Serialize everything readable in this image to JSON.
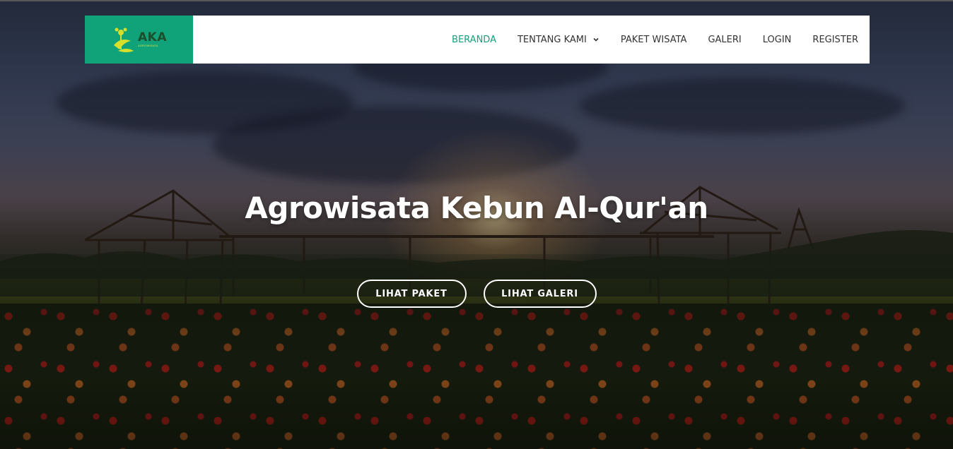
{
  "logo": {
    "title": "AKA",
    "subtitle": "AGROWISATA",
    "icon": "leaf-flower-icon",
    "bg_color": "#10a37a"
  },
  "nav": {
    "items": [
      {
        "label": "BERANDA",
        "active": true
      },
      {
        "label": "TENTANG KAMI",
        "has_dropdown": true
      },
      {
        "label": "PAKET WISATA"
      },
      {
        "label": "GALERI"
      },
      {
        "label": "LOGIN"
      },
      {
        "label": "REGISTER"
      }
    ],
    "active_color": "#10a37a",
    "text_color": "#333333",
    "dropdown_icon": "chevron-down-icon"
  },
  "hero": {
    "title": "Agrowisata Kebun Al-Qur'an",
    "buttons": [
      {
        "label": "LIHAT PAKET"
      },
      {
        "label": "LIHAT GALERI"
      }
    ]
  }
}
